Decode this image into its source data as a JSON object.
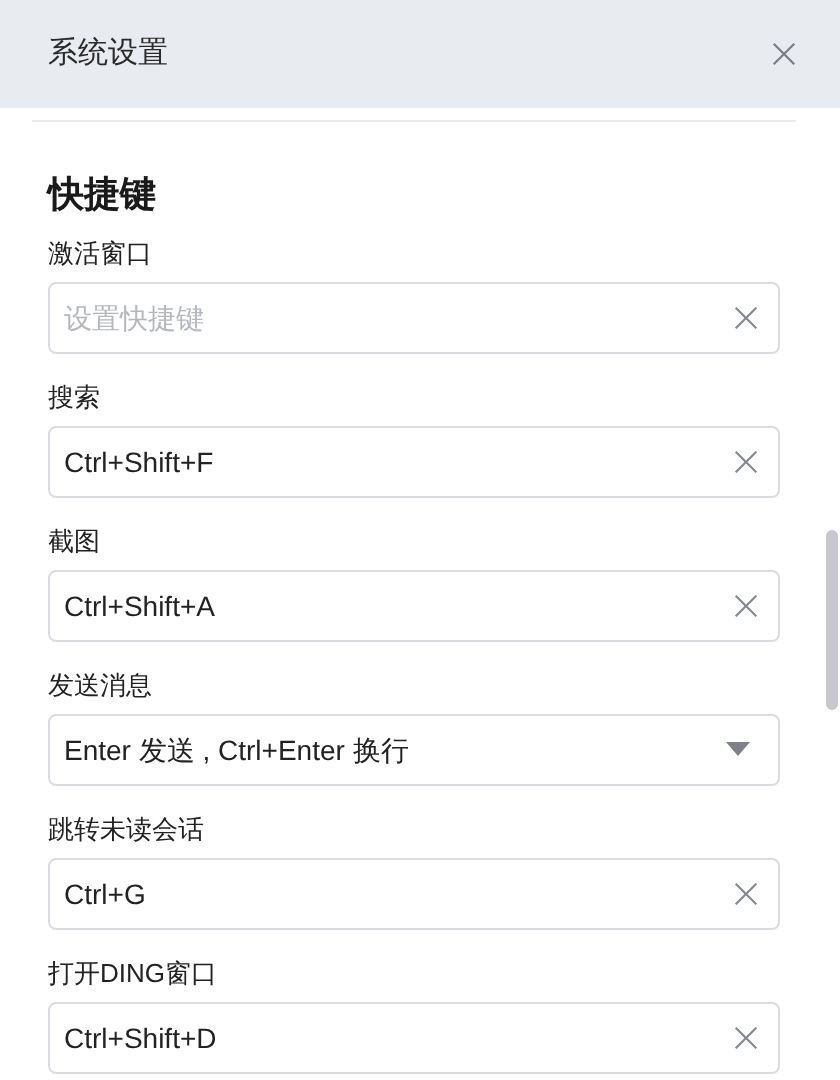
{
  "window": {
    "title": "系统设置"
  },
  "section": {
    "title": "快捷键"
  },
  "settings": [
    {
      "label": "激活窗口",
      "kind": "shortcut",
      "placeholder": "设置快捷键"
    },
    {
      "label": "搜索",
      "kind": "shortcut",
      "value": "Ctrl+Shift+F"
    },
    {
      "label": "截图",
      "kind": "shortcut",
      "value": "Ctrl+Shift+A"
    },
    {
      "label": "发送消息",
      "kind": "select",
      "value": "Enter 发送 , Ctrl+Enter 换行"
    },
    {
      "label": "跳转未读会话",
      "kind": "shortcut",
      "value": "Ctrl+G"
    },
    {
      "label": "打开DING窗口",
      "kind": "shortcut",
      "value": "Ctrl+Shift+D"
    }
  ]
}
